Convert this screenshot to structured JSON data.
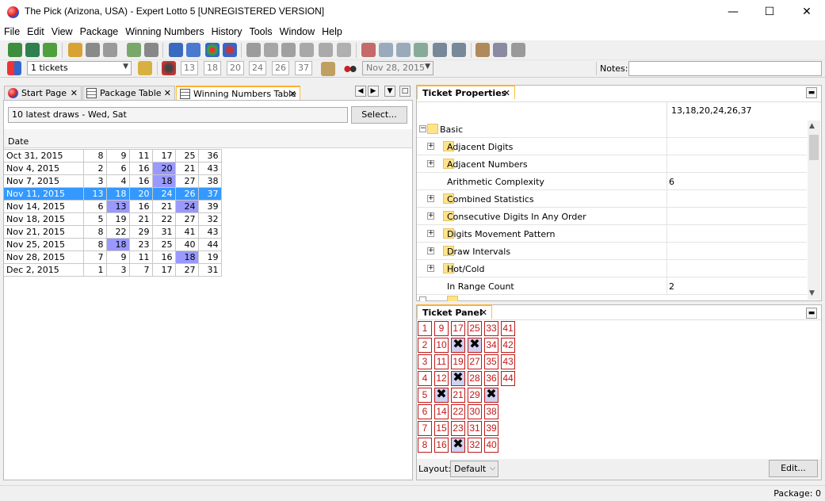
{
  "window": {
    "title": "The Pick (Arizona, USA) - Expert Lotto 5 [UNREGISTERED VERSION]",
    "min": "—",
    "max": "☐",
    "close": "✕"
  },
  "menu": [
    "File",
    "Edit",
    "View",
    "Package",
    "Winning Numbers",
    "History",
    "Tools",
    "Window",
    "Help"
  ],
  "toolbar2": {
    "tickets": "1 tickets",
    "numbers": [
      "13",
      "18",
      "20",
      "24",
      "26",
      "37"
    ],
    "date": "Nov 28, 2015",
    "notes_label": "Notes:",
    "notes_value": ""
  },
  "tabs": [
    {
      "label": "Start Page",
      "close": "✕"
    },
    {
      "label": "Package Table",
      "close": "✕"
    },
    {
      "label": "Winning Numbers Table",
      "close": "✕"
    }
  ],
  "draws": {
    "filter": "10 latest draws - Wed, Sat",
    "select_button": "Select...",
    "date_header": "Date",
    "rows": [
      {
        "date": "Oct 31, 2015",
        "n": [
          "8",
          "9",
          "11",
          "17",
          "25",
          "36"
        ]
      },
      {
        "date": "Nov 4, 2015",
        "n": [
          "2",
          "6",
          "16",
          "20",
          "21",
          "43"
        ]
      },
      {
        "date": "Nov 7, 2015",
        "n": [
          "3",
          "4",
          "16",
          "18",
          "27",
          "38"
        ]
      },
      {
        "date": "Nov 11, 2015",
        "n": [
          "13",
          "18",
          "20",
          "24",
          "26",
          "37"
        ]
      },
      {
        "date": "Nov 14, 2015",
        "n": [
          "6",
          "13",
          "16",
          "21",
          "24",
          "39"
        ]
      },
      {
        "date": "Nov 18, 2015",
        "n": [
          "5",
          "19",
          "21",
          "22",
          "27",
          "32"
        ]
      },
      {
        "date": "Nov 21, 2015",
        "n": [
          "8",
          "22",
          "29",
          "31",
          "41",
          "43"
        ]
      },
      {
        "date": "Nov 25, 2015",
        "n": [
          "8",
          "18",
          "23",
          "25",
          "40",
          "44"
        ]
      },
      {
        "date": "Nov 28, 2015",
        "n": [
          "7",
          "9",
          "11",
          "16",
          "18",
          "19"
        ]
      },
      {
        "date": "Dec 2, 2015",
        "n": [
          "1",
          "3",
          "7",
          "17",
          "27",
          "31"
        ]
      }
    ],
    "highlight_color": "#9999ff",
    "selected_color": "#3399ff"
  },
  "properties": {
    "tab": "Ticket Properties",
    "close": "✕",
    "ticket": "13,18,20,24,26,37",
    "rows": [
      {
        "label": "Basic",
        "value": "",
        "exp": "minus"
      },
      {
        "label": "Adjacent Digits",
        "value": "",
        "exp": "plus"
      },
      {
        "label": "Adjacent Numbers",
        "value": "",
        "exp": "plus"
      },
      {
        "label": "Arithmetic Complexity",
        "value": "6",
        "exp": ""
      },
      {
        "label": "Combined Statistics",
        "value": "",
        "exp": "plus"
      },
      {
        "label": "Consecutive Digits In Any Order",
        "value": "",
        "exp": "plus"
      },
      {
        "label": "Digits Movement Pattern",
        "value": "",
        "exp": "plus"
      },
      {
        "label": "Draw Intervals",
        "value": "",
        "exp": "plus"
      },
      {
        "label": "Hot/Cold",
        "value": "",
        "exp": "plus"
      },
      {
        "label": "In Range Count",
        "value": "2",
        "exp": ""
      }
    ]
  },
  "ticket_panel": {
    "tab": "Ticket Panel",
    "close": "✕",
    "marked": [
      "13",
      "18",
      "20",
      "24",
      "26",
      "37"
    ],
    "layout_label": "Layout:",
    "layout_value": "Default",
    "edit_button": "Edit..."
  },
  "status": {
    "package": "Package: 0"
  }
}
